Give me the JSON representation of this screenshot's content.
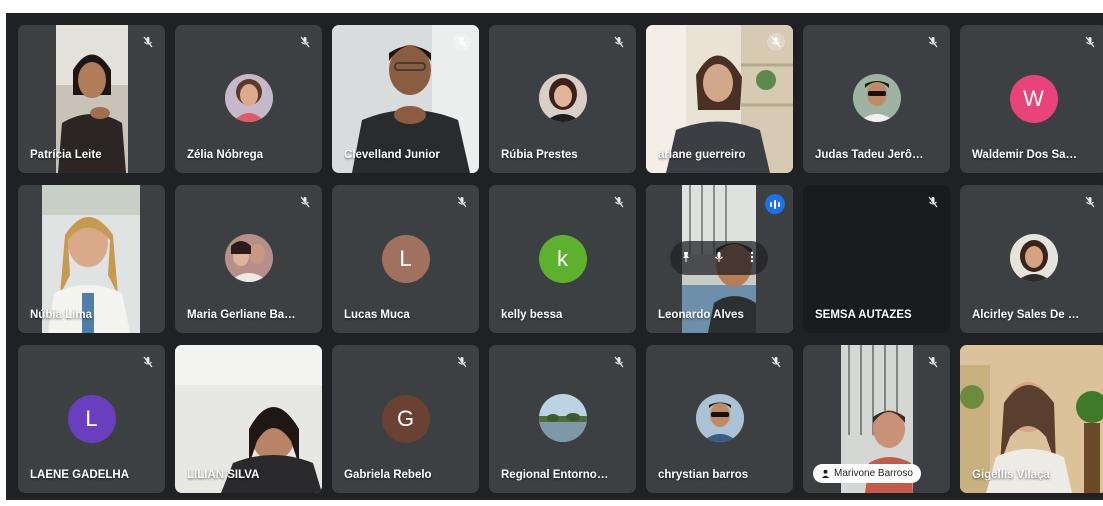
{
  "meeting": {
    "participants": [
      {
        "name": "Patrícia Leite",
        "view": "video"
      },
      {
        "name": "Zélia Nóbrega",
        "view": "avatar"
      },
      {
        "name": "Clevelland Junior",
        "view": "video"
      },
      {
        "name": "Rúbia Prestes",
        "view": "avatar"
      },
      {
        "name": "ariane guerreiro",
        "view": "video"
      },
      {
        "name": "Judas Tadeu Jerônimo d...",
        "view": "avatar"
      },
      {
        "name": "Waldemir Dos Santos Al...",
        "view": "letter",
        "initial": "W",
        "color": "#e8447a"
      },
      {
        "name": "Núbia Lima",
        "view": "video"
      },
      {
        "name": "Maria Gerliane Barboza ...",
        "view": "avatar"
      },
      {
        "name": "Lucas Muca",
        "view": "letter",
        "initial": "L",
        "color": "#a0715f"
      },
      {
        "name": "kelly bessa",
        "view": "letter",
        "initial": "k",
        "color": "#5db12f"
      },
      {
        "name": "Leonardo Alves",
        "view": "video",
        "speaking": true
      },
      {
        "name": "SEMSA AUTAZES",
        "view": "blank"
      },
      {
        "name": "Alcirley Sales De França",
        "view": "avatar"
      },
      {
        "name": "LAENE GADELHA",
        "view": "letter",
        "initial": "L",
        "color": "#6a3fbf"
      },
      {
        "name": "LILIAN SILVA",
        "view": "video"
      },
      {
        "name": "Gabriela Rebelo",
        "view": "letter",
        "initial": "G",
        "color": "#6b4134"
      },
      {
        "name": "Regional Entorno e RN",
        "view": "avatar"
      },
      {
        "name": "chrystian barros",
        "view": "avatar"
      },
      {
        "name": "Marivone Barroso",
        "view": "video"
      },
      {
        "name": "Gigellis Vilaça",
        "view": "video"
      }
    ]
  },
  "colors": {
    "background": "#202124",
    "tile": "#3c4043",
    "speaking_outline": "#8ab4f8",
    "speaking_badge": "#1a73e8"
  }
}
